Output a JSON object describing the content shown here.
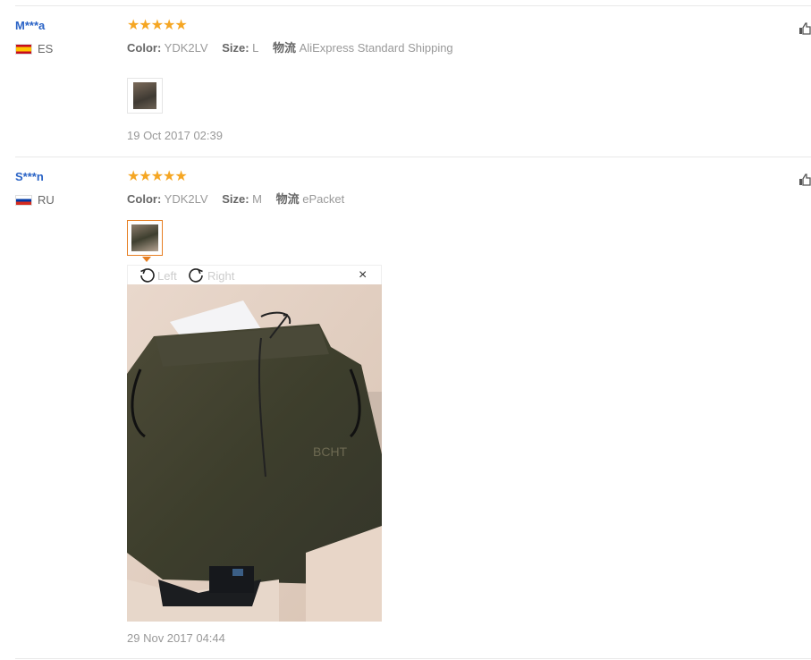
{
  "reviews": [
    {
      "user": "M***a",
      "country_code": "ES",
      "stars": "★★★★★",
      "color_label": "Color:",
      "color_value": "YDK2LV",
      "size_label": "Size:",
      "size_value": "L",
      "shipping_label": "物流",
      "shipping_value": "AliExpress Standard Shipping",
      "date": "19 Oct 2017 02:39"
    },
    {
      "user": "S***n",
      "country_code": "RU",
      "stars": "★★★★★",
      "color_label": "Color:",
      "color_value": "YDK2LV",
      "size_label": "Size:",
      "size_value": "M",
      "shipping_label": "物流",
      "shipping_value": "ePacket",
      "date": "29 Nov 2017 04:44"
    }
  ],
  "viewer": {
    "rotate_left": "Left",
    "rotate_right": "Right",
    "close": "×",
    "photo_print": "BCHT"
  },
  "colors": {
    "user_link": "#2a63c6",
    "star": "#f5a623",
    "active_border": "#e67e22"
  }
}
